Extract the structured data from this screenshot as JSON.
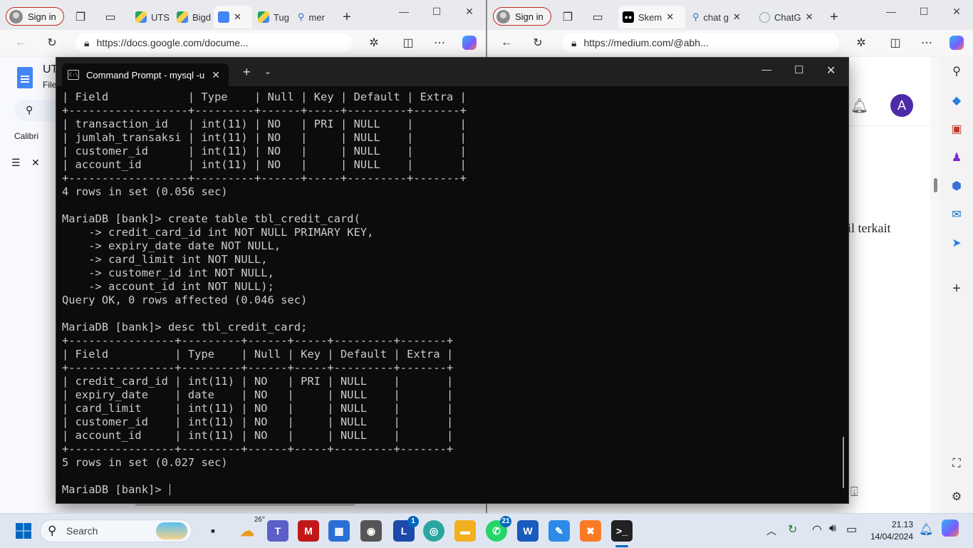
{
  "left_browser": {
    "sign_in": "Sign in",
    "tabs": [
      "UTS",
      "Bigd",
      "",
      "Tug",
      "mer"
    ],
    "url": "https://docs.google.com/docume...",
    "docs": {
      "title": "UT",
      "menu": "File",
      "font": "Calibri"
    }
  },
  "right_browser": {
    "sign_in": "Sign in",
    "tabs": [
      "Skem",
      "chat g",
      "ChatG"
    ],
    "url": "https://medium.com/@abh...",
    "avatar_letter": "A",
    "snippet": "il terkait"
  },
  "terminal": {
    "tab_title": "Command Prompt - mysql  -u",
    "icon_text": "C:\\",
    "lines": [
      "| Field            | Type    | Null | Key | Default | Extra |",
      "+------------------+---------+------+-----+---------+-------+",
      "| transaction_id   | int(11) | NO   | PRI | NULL    |       |",
      "| jumlah_transaksi | int(11) | NO   |     | NULL    |       |",
      "| customer_id      | int(11) | NO   |     | NULL    |       |",
      "| account_id       | int(11) | NO   |     | NULL    |       |",
      "+------------------+---------+------+-----+---------+-------+",
      "4 rows in set (0.056 sec)",
      "",
      "MariaDB [bank]> create table tbl_credit_card(",
      "    -> credit_card_id int NOT NULL PRIMARY KEY,",
      "    -> expiry_date date NOT NULL,",
      "    -> card_limit int NOT NULL,",
      "    -> customer_id int NOT NULL,",
      "    -> account_id int NOT NULL);",
      "Query OK, 0 rows affected (0.046 sec)",
      "",
      "MariaDB [bank]> desc tbl_credit_card;",
      "+----------------+---------+------+-----+---------+-------+",
      "| Field          | Type    | Null | Key | Default | Extra |",
      "+----------------+---------+------+-----+---------+-------+",
      "| credit_card_id | int(11) | NO   | PRI | NULL    |       |",
      "| expiry_date    | date    | NO   |     | NULL    |       |",
      "| card_limit     | int(11) | NO   |     | NULL    |       |",
      "| customer_id    | int(11) | NO   |     | NULL    |       |",
      "| account_id     | int(11) | NO   |     | NULL    |       |",
      "+----------------+---------+------+-----+---------+-------+",
      "5 rows in set (0.027 sec)",
      ""
    ],
    "prompt": "MariaDB [bank]> "
  },
  "taskbar": {
    "search": "Search",
    "weather_temp": "26°",
    "badges": {
      "l_app": "1",
      "whatsapp": "21"
    },
    "time": "21.13",
    "date": "14/04/2024"
  },
  "colors": {
    "accent": "#0067c0",
    "terminal_bg": "#0c0c0c",
    "terminal_fg": "#cccccc"
  }
}
